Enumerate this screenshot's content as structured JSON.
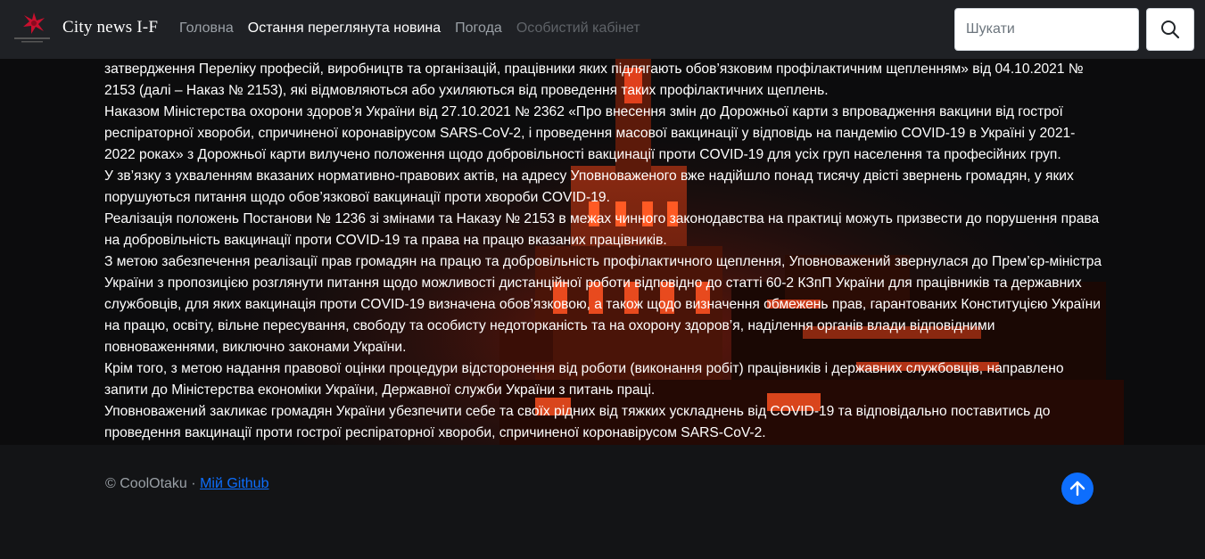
{
  "navbar": {
    "brand_name": "City news I-F",
    "links": [
      {
        "label": "Головна",
        "state": "normal"
      },
      {
        "label": "Остання переглянута новина",
        "state": "active"
      },
      {
        "label": "Погода",
        "state": "normal"
      },
      {
        "label": "Особистий кабінет",
        "state": "disabled"
      }
    ],
    "search_placeholder": "Шукати",
    "search_icon": "search-icon"
  },
  "article": {
    "paragraphs": [
      "затвердження Переліку професій, виробництв та організацій, працівники яких підлягають обов’язковим профілактичним щепленням» від 04.10.2021 № 2153 (далі – Наказ № 2153), які відмовляються або ухиляються від проведення таких профілактичних щеплень.",
      "Наказом Міністерства охорони здоров’я України від 27.10.2021 № 2362 «Про внесення змін до Дорожньої карти з впровадження вакцини від гострої респіраторної хвороби, спричиненої коронавірусом SARS-CoV-2, і проведення масової вакцинації у відповідь на пандемію COVID-19 в Україні у 2021-2022 роках» з Дорожньої карти вилучено положення щодо добровільності вакцинації проти COVID-19 для усіх груп населення та професійних груп.",
      "У зв’язку з ухваленням вказаних нормативно-правових актів, на адресу Уповноваженого вже надійшло понад тисячу двісті звернень громадян, у яких порушуються питання щодо обов’язкової вакцинації проти хвороби COVID-19.",
      "Реалізація положень Постанови № 1236 зі змінами та Наказу № 2153 в межах чинного законодавства на практиці можуть призвести до порушення права на добровільність вакцинації проти COVID-19 та права на працю вказаних працівників.",
      "З метою забезпечення реалізації прав громадян на працю та добровільність профілактичного щеплення, Уповноважений звернулася до Прем’єр-міністра України з пропозицією розглянути питання щодо можливості дистанційної роботи відповідно до статті 60-2 КЗпП України для працівників та державних службовців, для яких вакцинація проти COVID-19 визначена обов’язковою, а також щодо визначення обмежень прав, гарантованих Конституцією України на працю, освіту, вільне пересування, свободу та особисту недоторканість та на охорону здоров’я, наділення органів влади відповідними повноваженнями, виключно законами України.",
      "Крім того, з метою надання правової оцінки процедури відсторонення від роботи (виконання робіт) працівників і державних службовців, направлено запити до Міністерства економіки України, Державної служби України з питань праці.",
      "Уповноважений закликає громадян України убезпечити себе та своїх рідних від тяжких ускладнень від COVID-19 та відповідально поставитись до проведення вакцинації проти гострої респіраторної хвороби, спричиненої коронавірусом SARS-CoV-2."
    ]
  },
  "footer": {
    "copyright": "© CoolOtaku ·",
    "github_link": "Мій Github",
    "to_top_icon": "arrow-up-icon"
  },
  "colors": {
    "navbar_bg": "#1f2125",
    "page_bg": "#131416",
    "link_blue": "#0d6efd",
    "accent_red": "#d63a1a"
  }
}
